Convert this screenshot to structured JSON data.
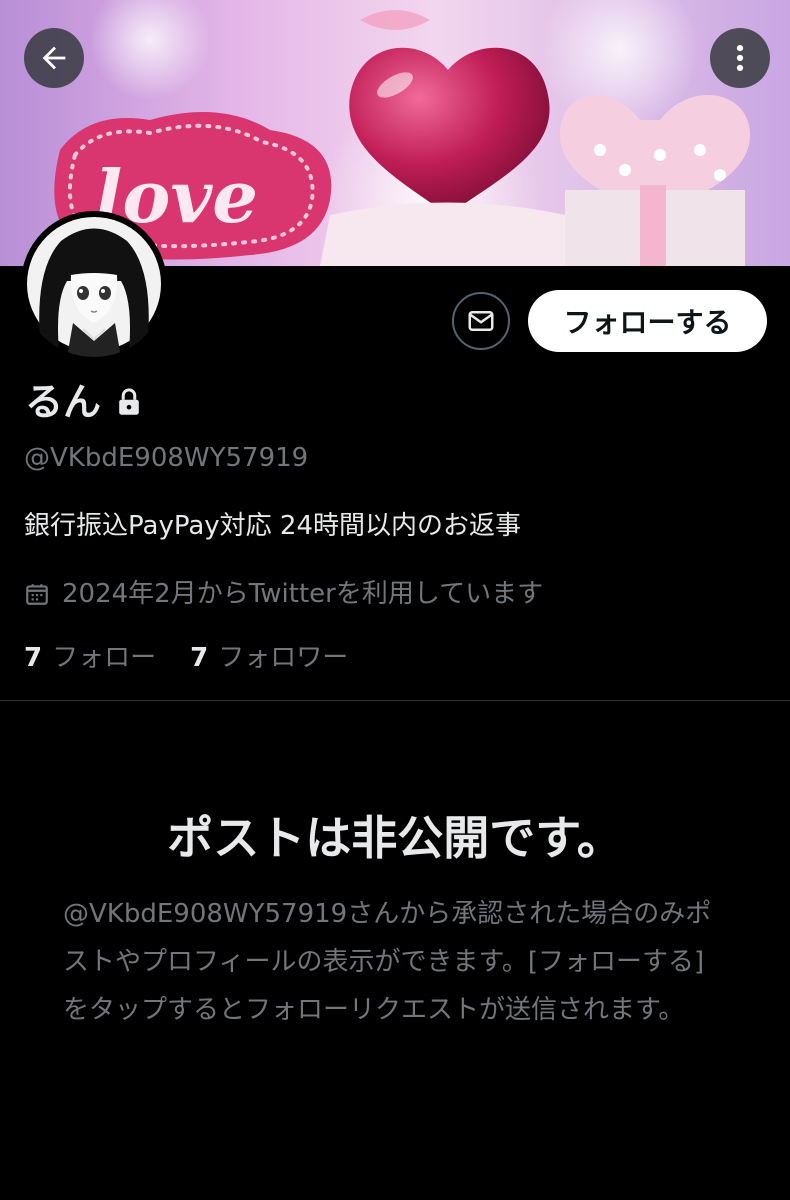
{
  "header": {
    "back_icon": "arrow-left-icon",
    "more_icon": "more-vertical-icon",
    "banner_text": "love"
  },
  "profile": {
    "display_name": "るん",
    "lock_icon": "lock-icon",
    "handle": "@VKbdE908WY57919",
    "bio": "銀行振込PayPay対応 24時間以内のお返事",
    "joined_icon": "calendar-icon",
    "joined": "2024年2月からTwitterを利用しています",
    "following_count": "7",
    "following_label": "フォロー",
    "followers_count": "7",
    "followers_label": "フォロワー"
  },
  "actions": {
    "message_icon": "envelope-icon",
    "follow_label": "フォローする"
  },
  "protected": {
    "title": "ポストは非公開です。",
    "description": "@VKbdE908WY57919さんから承認された場合のみポストやプロフィールの表示ができます。[フォローする] をタップするとフォローリクエストが送信されます。"
  },
  "colors": {
    "background": "#000000",
    "text_primary": "#e7e9ea",
    "text_secondary": "#71767b",
    "divider": "#2f3336",
    "follow_button_bg": "#ffffff",
    "follow_button_text": "#0f1419"
  }
}
